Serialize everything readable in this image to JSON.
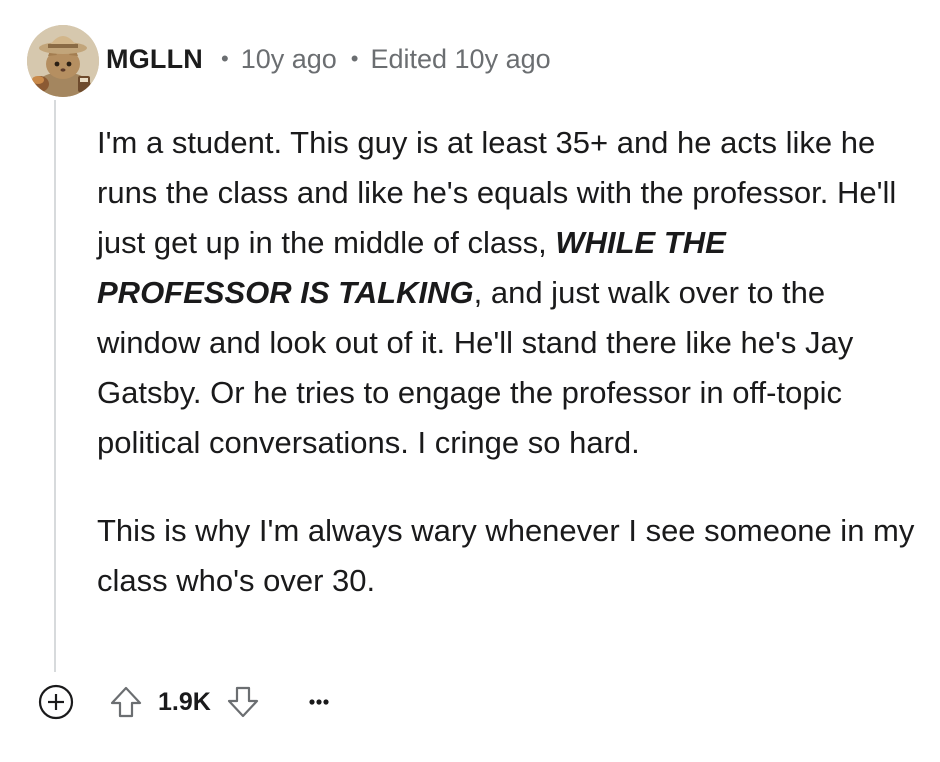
{
  "theme": {
    "background": "#ffffff",
    "thread_line": "#d7dadc",
    "meta_color": "#6b6e71"
  },
  "comment": {
    "author": "MGLLN",
    "separator": "•",
    "age": "10y ago",
    "edited": "Edited 10y ago",
    "paragraph1": {
      "before": "I'm a student. This guy is at least 35+ and he acts like he runs the class and like he's equals with the professor. He'll just get up in the middle of class, ",
      "emphasis": "WHILE THE PROFESSOR IS TALKING",
      "after": ", and just walk over to the window and look out of it. He'll stand there like he's Jay Gatsby. Or he tries to engage the professor in off-topic political conversations. I cringe so hard."
    },
    "paragraph2": "This is why I'm always wary whenever I see someone in my class who's over 30."
  },
  "actions": {
    "expand_icon": "plus-circle-icon",
    "upvote_icon": "arrow-up-icon",
    "score": "1.9K",
    "downvote_icon": "arrow-down-icon",
    "more_icon": "ellipsis-icon"
  }
}
